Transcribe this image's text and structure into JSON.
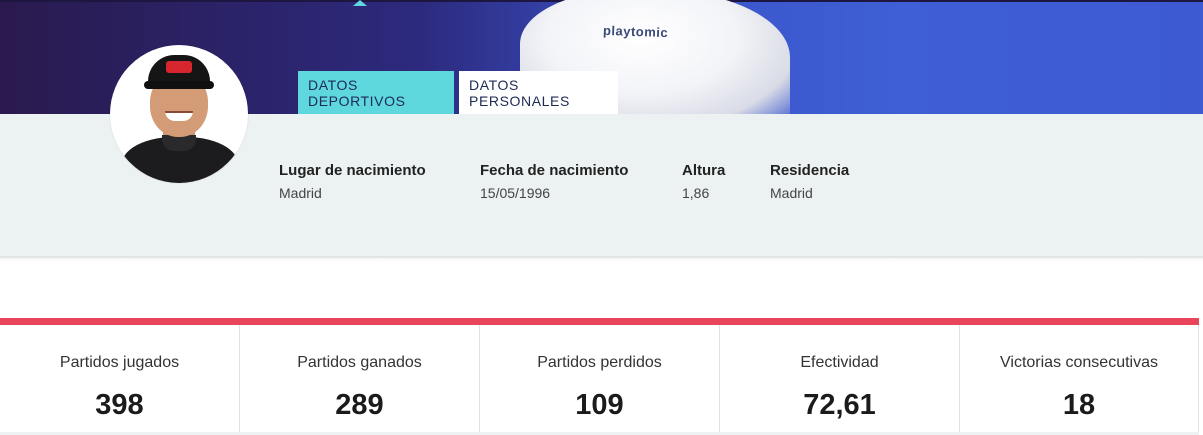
{
  "hero": {
    "sponsor_text": "playtomic"
  },
  "tabs": [
    {
      "label": "DATOS DEPORTIVOS",
      "active": true
    },
    {
      "label": "DATOS PERSONALES",
      "active": false
    }
  ],
  "personal": {
    "fields": [
      {
        "label": "Lugar de nacimiento",
        "value": "Madrid"
      },
      {
        "label": "Fecha de nacimiento",
        "value": "15/05/1996"
      },
      {
        "label": "Altura",
        "value": "1,86"
      },
      {
        "label": "Residencia",
        "value": "Madrid"
      }
    ]
  },
  "stats": [
    {
      "label": "Partidos jugados",
      "value": "398"
    },
    {
      "label": "Partidos ganados",
      "value": "289"
    },
    {
      "label": "Partidos perdidos",
      "value": "109"
    },
    {
      "label": "Efectividad",
      "value": "72,61"
    },
    {
      "label": "Victorias consecutivas",
      "value": "18"
    }
  ],
  "colors": {
    "tab_active": "#5fd8dd",
    "stats_accent": "#e8455a",
    "panel_bg": "#ecf1f1",
    "hero_blue": "#3f5fd6"
  }
}
